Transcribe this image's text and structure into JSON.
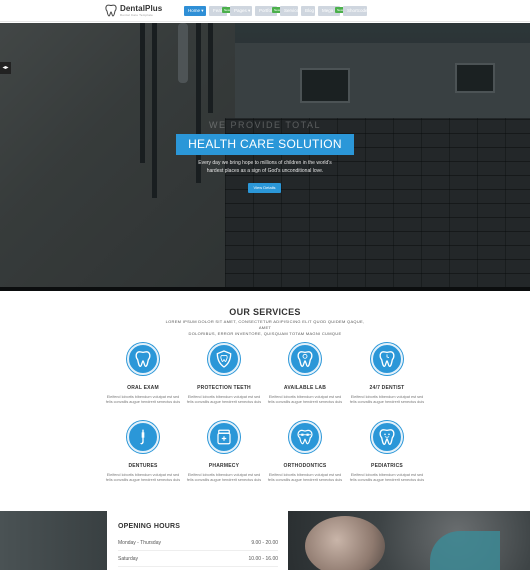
{
  "header": {
    "logo_name": "DentalPlus",
    "logo_tagline": "Dental Care Template",
    "nav": [
      {
        "label": "Home ▾",
        "active": true,
        "badge": ""
      },
      {
        "label": "Features",
        "active": false,
        "badge": "New"
      },
      {
        "label": "Pages ▾",
        "active": false,
        "badge": ""
      },
      {
        "label": "Portfolio",
        "active": false,
        "badge": "New"
      },
      {
        "label": "Services ▾",
        "active": false,
        "badge": ""
      },
      {
        "label": "Blog",
        "active": false,
        "badge": ""
      },
      {
        "label": "Mega Menu",
        "active": false,
        "badge": "New"
      },
      {
        "label": "Shortcodes ▾",
        "active": false,
        "badge": ""
      }
    ]
  },
  "hero": {
    "side_icon": "arrow-icon",
    "overline": "WE PROVIDE TOTAL",
    "title": "HEALTH CARE SOLUTION",
    "subtitle_line1": "Every day we bring hope to millions of children in the world's",
    "subtitle_line2": "hardest places as a sign of God's unconditional love.",
    "button": "View Details"
  },
  "services": {
    "title": "OUR SERVICES",
    "desc_line1": "LOREM IPSUM DOLOR SIT AMET, CONSECTETUR ADIPISICING ELIT QUOD QUIDEM QAQUE, AMET",
    "desc_line2": "DOLORIBUS, ERROR INVENTORE, QUISQUAM TOTAM MAGNI CUMQUE",
    "items": [
      {
        "name": "ORAL EXAM",
        "icon": "tooth-icon",
        "text": "Eleifend lobortis bibendum volutpat est sed felis convallis augue hendrerit senectus duis"
      },
      {
        "name": "PROTECTION TEETH",
        "icon": "shield-tooth-icon",
        "text": "Eleifend lobortis bibendum volutpat est sed felis convallis augue hendrerit senectus duis"
      },
      {
        "name": "AVAILABLE LAB",
        "icon": "lab-tooth-icon",
        "text": "Eleifend lobortis bibendum volutpat est sed felis convallis augue hendrerit senectus duis"
      },
      {
        "name": "24/7 DENTIST",
        "icon": "clock-tooth-icon",
        "text": "Eleifend lobortis bibendum volutpat est sed felis convallis augue hendrerit senectus duis"
      },
      {
        "name": "DENTURES",
        "icon": "probe-icon",
        "text": "Eleifend lobortis bibendum volutpat est sed felis convallis augue hendrerit senectus duis"
      },
      {
        "name": "PHARMECY",
        "icon": "pill-jar-icon",
        "text": "Eleifend lobortis bibendum volutpat est sed felis convallis augue hendrerit senectus duis"
      },
      {
        "name": "ORTHODONTICS",
        "icon": "braces-icon",
        "text": "Eleifend lobortis bibendum volutpat est sed felis convallis augue hendrerit senectus duis"
      },
      {
        "name": "PEDIATRICS",
        "icon": "kid-tooth-icon",
        "text": "Eleifend lobortis bibendum volutpat est sed felis convallis augue hendrerit senectus duis"
      }
    ]
  },
  "hours": {
    "title": "OPENING HOURS",
    "rows": [
      {
        "day": "Monday - Thursday",
        "time": "9.00 - 20.00"
      },
      {
        "day": "Saturday",
        "time": "10.00 - 16.00"
      }
    ]
  },
  "colors": {
    "accent": "#2b97d8",
    "badge": "#4cb04c"
  }
}
